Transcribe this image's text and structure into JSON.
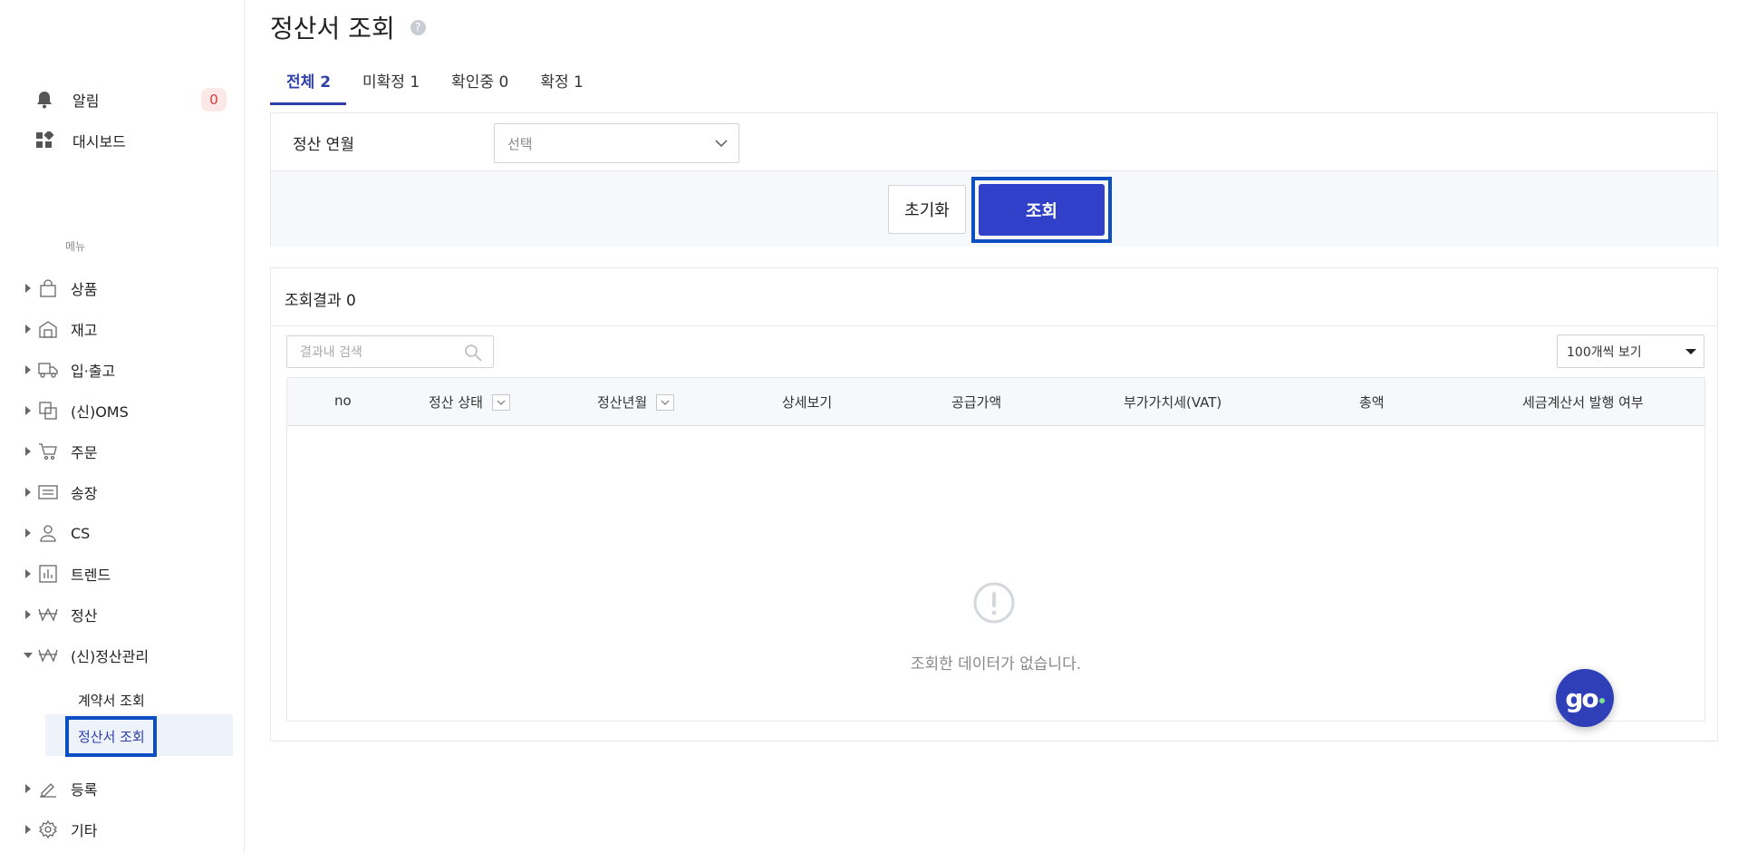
{
  "sidebar": {
    "alerts": {
      "label": "알림",
      "count": "0",
      "icon": "bell-icon"
    },
    "dashboard": {
      "label": "대시보드",
      "icon": "dashboard-icon"
    },
    "menu_caption": "메뉴",
    "items": [
      {
        "label": "상품",
        "icon": "bag-icon"
      },
      {
        "label": "재고",
        "icon": "warehouse-icon"
      },
      {
        "label": "입·출고",
        "icon": "truck-icon"
      },
      {
        "label": "(신)OMS",
        "icon": "oms-icon"
      },
      {
        "label": "주문",
        "icon": "cart-icon"
      },
      {
        "label": "송장",
        "icon": "invoice-icon"
      },
      {
        "label": "CS",
        "icon": "user-icon"
      },
      {
        "label": "트렌드",
        "icon": "chart-icon"
      },
      {
        "label": "정산",
        "icon": "won-icon"
      },
      {
        "label": "(신)정산관리",
        "icon": "won-icon",
        "expanded": true
      },
      {
        "label": "등록",
        "icon": "pencil-icon"
      },
      {
        "label": "기타",
        "icon": "gear-icon"
      }
    ],
    "sub_items": [
      {
        "label": "계약서 조회"
      },
      {
        "label": "정산서 조회",
        "active": true
      }
    ]
  },
  "page": {
    "title": "정산서 조회"
  },
  "tabs": [
    {
      "label": "전체 2",
      "active": true
    },
    {
      "label": "미확정 1"
    },
    {
      "label": "확인중 0"
    },
    {
      "label": "확정 1"
    }
  ],
  "filter": {
    "period_label": "정산 연월",
    "period_placeholder": "선택",
    "reset_label": "초기화",
    "search_label": "조회"
  },
  "results": {
    "title": "조회결과 0",
    "search_placeholder": "결과내 검색",
    "per_page": "100개씩 보기",
    "columns": [
      "no",
      "정산 상태",
      "정산년월",
      "상세보기",
      "공급가액",
      "부가가치세(VAT)",
      "총액",
      "세금계산서 발행 여부"
    ],
    "empty_message": "조회한 데이터가 없습니다."
  },
  "fab": {
    "label": "go"
  },
  "colors": {
    "accent": "#3040c8",
    "highlight": "#0b4fc2",
    "badge_text": "#d43a3a"
  }
}
